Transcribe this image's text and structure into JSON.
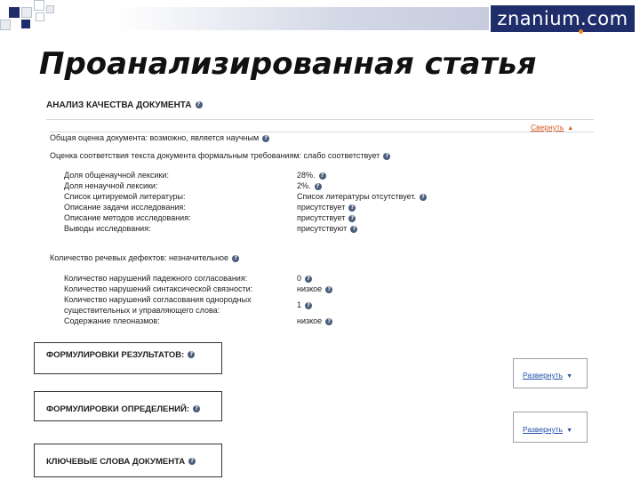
{
  "logo": {
    "text": "znanium.com"
  },
  "slide_title": "Проанализированная статья",
  "quality": {
    "title": "АНАЛИЗ КАЧЕСТВА ДОКУМЕНТА",
    "collapse_label": "Свернуть",
    "overall": "Общая оценка документа: возможно, является научным",
    "formal": "Оценка соответствия текста документа формальным требованиям: слабо соответствует",
    "formal_rows": [
      {
        "label": "Доля общенаучной лексики:",
        "value": "28%."
      },
      {
        "label": "Доля ненаучной лексики:",
        "value": "2%."
      },
      {
        "label": "Список цитируемой литературы:",
        "value": "Список литературы отсутствует."
      },
      {
        "label": "Описание задачи исследования:",
        "value": "присутствует"
      },
      {
        "label": "Описание методов исследования:",
        "value": "присутствует"
      },
      {
        "label": "Выводы исследования:",
        "value": "присутствуют"
      }
    ],
    "defects": "Количество речевых дефектов: незначительное",
    "defect_rows": [
      {
        "label": "Количество нарушений падежного согласования:",
        "value": "0"
      },
      {
        "label": "Количество нарушений синтаксической связности:",
        "value": "низкое"
      },
      {
        "label": "Количество нарушений согласования однородных",
        "label2": "существительных и управляющего слова:",
        "value": "1"
      },
      {
        "label": "Содержание плеоназмов:",
        "value": "низкое"
      }
    ]
  },
  "results": {
    "title": "ФОРМУЛИРОВКИ РЕЗУЛЬТАТОВ:",
    "expand_label": "Развернуть"
  },
  "definitions": {
    "title": "ФОРМУЛИРОВКИ ОПРЕДЕЛЕНИЙ:",
    "expand_label": "Развернуть"
  },
  "keywords": {
    "title": "КЛЮЧЕВЫЕ СЛОВА ДОКУМЕНТА"
  },
  "icons": {
    "help": "help-icon",
    "collapse_arrow": "triangle-up-icon",
    "expand_arrow": "triangle-down-icon"
  }
}
